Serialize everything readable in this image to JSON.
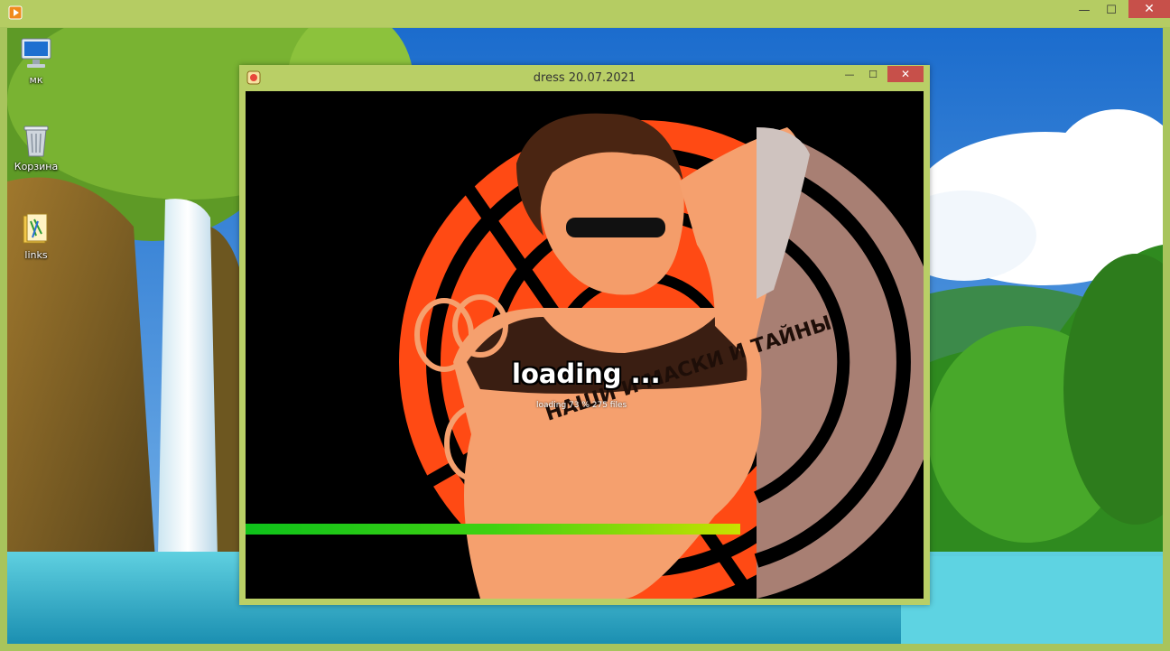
{
  "outer_window": {
    "controls": {
      "minimize": "—",
      "maximize": "☐",
      "close": "✕"
    }
  },
  "desktop": {
    "icons": [
      {
        "label": "мк",
        "icon": "computer-icon"
      },
      {
        "label": "Корзина",
        "icon": "recycle-bin-icon"
      },
      {
        "label": "links",
        "icon": "folder-icon"
      }
    ]
  },
  "app_window": {
    "title": "dress 20.07.2021",
    "controls": {
      "minimize": "—",
      "maximize": "☐",
      "close": "✕"
    },
    "loading": {
      "title": "loading ...",
      "status": "loading 73 %   275 files",
      "progress_percent": 73
    },
    "artwork_text": "НАШИ И МАСКИ И ТАЙНЫ",
    "colors": {
      "accent_orange": "#ff4a14",
      "frame_green": "#b9cf66",
      "progress_start": "#0ec21a",
      "progress_end": "#c9e100"
    }
  }
}
